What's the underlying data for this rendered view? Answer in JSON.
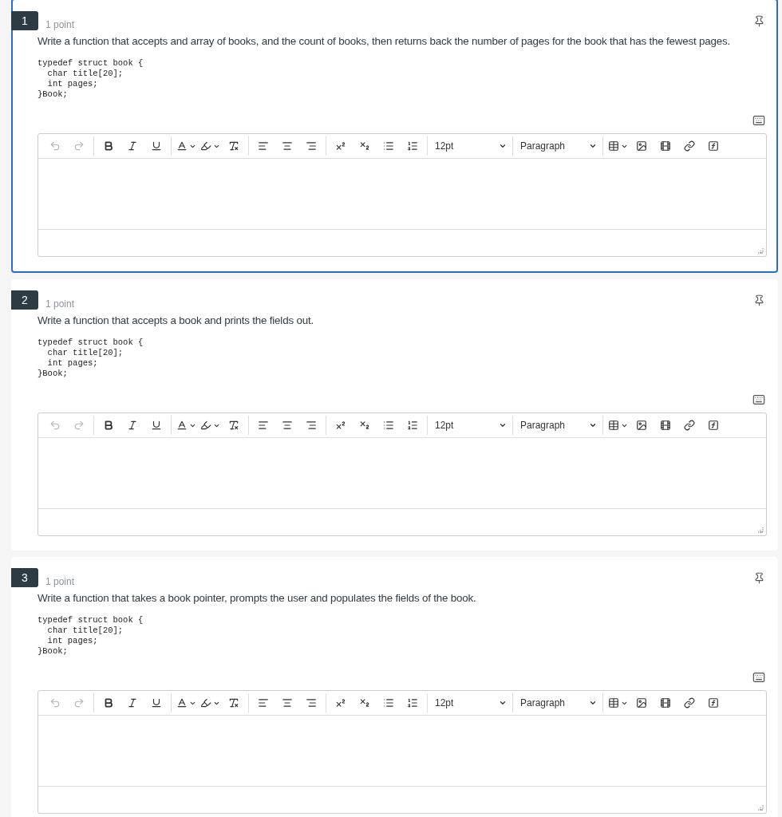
{
  "questions": [
    {
      "number": "1",
      "points": "1 point",
      "selected": true,
      "prompt": "Write a function that accepts and array of books, and the count of books, then returns back the number of pages for the book that has the fewest pages.",
      "code": [
        "typedef struct book {",
        "  char title[20];",
        "  int pages;",
        "}Book;"
      ],
      "editor": {
        "font_size": "12pt",
        "block_format": "Paragraph",
        "undo_disabled": true,
        "redo_disabled": true
      }
    },
    {
      "number": "2",
      "points": "1 point",
      "selected": false,
      "prompt": "Write a function that accepts a book and prints the fields out.",
      "code": [
        "typedef struct book {",
        "  char title[20];",
        "  int pages;",
        "}Book;"
      ],
      "editor": {
        "font_size": "12pt",
        "block_format": "Paragraph",
        "undo_disabled": true,
        "redo_disabled": true
      }
    },
    {
      "number": "3",
      "points": "1 point",
      "selected": false,
      "prompt": "Write a function that takes a book pointer, prompts the user and populates the fields of the book.",
      "code": [
        "typedef struct book {",
        "  char title[20];",
        "  int pages;",
        "}Book;"
      ],
      "editor": {
        "font_size": "12pt",
        "block_format": "Paragraph",
        "undo_disabled": true,
        "redo_disabled": true
      }
    }
  ]
}
